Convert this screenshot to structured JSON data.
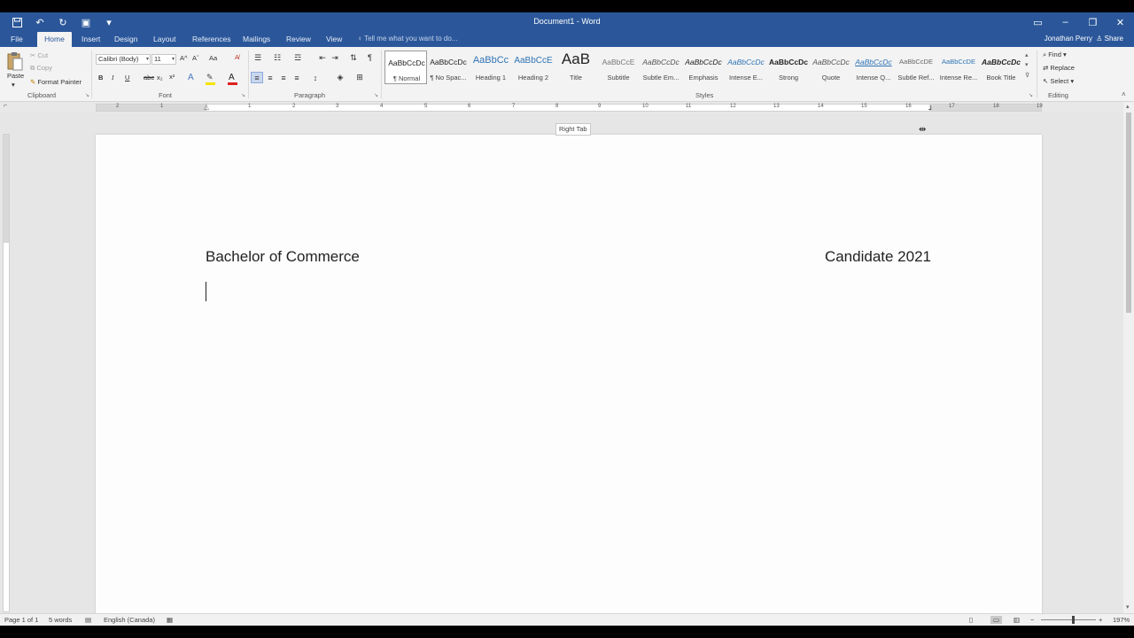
{
  "titlebar": {
    "title": "Document1 - Word",
    "qat_icons": [
      "save-icon",
      "undo-icon",
      "redo-icon",
      "touch-mode-icon",
      "customize-qat-icon"
    ],
    "window_controls": [
      "ribbon-display-icon",
      "minimize-icon",
      "restore-icon",
      "close-icon"
    ]
  },
  "tabs": {
    "items": [
      "File",
      "Home",
      "Insert",
      "Design",
      "Layout",
      "References",
      "Mailings",
      "Review",
      "View"
    ],
    "active": "Home",
    "tell_me": "Tell me what you want to do...",
    "user": "Jonathan Perry",
    "share": "Share"
  },
  "ribbon": {
    "clipboard": {
      "label": "Clipboard",
      "paste": "Paste",
      "cut": "Cut",
      "copy": "Copy",
      "format_painter": "Format Painter"
    },
    "font": {
      "label": "Font",
      "font_name": "Calibri (Body)",
      "font_size": "11",
      "bold": "B",
      "italic": "I",
      "underline": "U",
      "strikethrough": "abc",
      "subscript": "x₂",
      "superscript": "x²",
      "grow": "A^",
      "shrink": "Aˇ",
      "change_case": "Aa"
    },
    "paragraph": {
      "label": "Paragraph",
      "pilcrow": "¶"
    },
    "styles": {
      "label": "Styles",
      "items": [
        {
          "sample": "AaBbCcDc",
          "name": "¶ Normal"
        },
        {
          "sample": "AaBbCcDc",
          "name": "¶ No Spac..."
        },
        {
          "sample": "AaBbCc",
          "name": "Heading 1"
        },
        {
          "sample": "AaBbCcE",
          "name": "Heading 2"
        },
        {
          "sample": "AaB",
          "name": "Title"
        },
        {
          "sample": "AaBbCcE",
          "name": "Subtitle"
        },
        {
          "sample": "AaBbCcDc",
          "name": "Subtle Em..."
        },
        {
          "sample": "AaBbCcDc",
          "name": "Emphasis"
        },
        {
          "sample": "AaBbCcDc",
          "name": "Intense E..."
        },
        {
          "sample": "AaBbCcDc",
          "name": "Strong"
        },
        {
          "sample": "AaBbCcDc",
          "name": "Quote"
        },
        {
          "sample": "AaBbCcDc",
          "name": "Intense Q..."
        },
        {
          "sample": "AaBbCcDE",
          "name": "Subtle Ref..."
        },
        {
          "sample": "AaBbCcDE",
          "name": "Intense Re..."
        },
        {
          "sample": "AaBbCcDc",
          "name": "Book Title"
        }
      ]
    },
    "editing": {
      "label": "Editing",
      "find": "Find",
      "replace": "Replace",
      "select": "Select"
    }
  },
  "ruler": {
    "numbers": [
      "2",
      "1",
      "1",
      "2",
      "3",
      "4",
      "5",
      "6",
      "7",
      "8",
      "9",
      "10",
      "11",
      "12",
      "13",
      "14",
      "15",
      "16",
      "17",
      "18",
      "19"
    ]
  },
  "document": {
    "left_text": "Bachelor of Commerce",
    "right_text": "Candidate 2021",
    "tooltip": "Right Tab"
  },
  "statusbar": {
    "page": "Page 1 of 1",
    "words": "5 words",
    "language": "English (Canada)",
    "zoom": "197%"
  },
  "colors": {
    "accent": "#2b579a",
    "ribbon_bg": "#f3f3f3",
    "workspace_bg": "#e6e6e6"
  }
}
